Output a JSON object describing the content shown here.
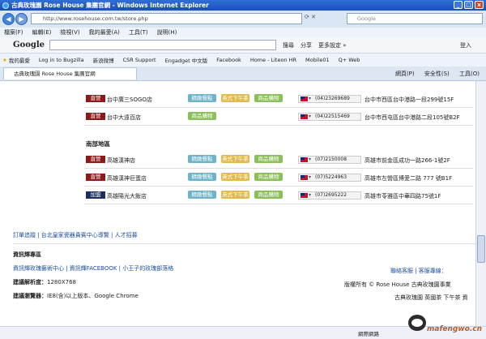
{
  "window": {
    "title": "古典玫瑰園 Rose House 集團官網 - Windows Internet Explorer",
    "controls": [
      "_",
      "□",
      "x"
    ]
  },
  "addressbar": {
    "url": "http://www.rosehouse.com.tw/store.php",
    "search_placeholder": "Google"
  },
  "menu": [
    "檔案(F)",
    "編輯(E)",
    "檢視(V)",
    "我的最愛(A)",
    "工具(T)",
    "說明(H)"
  ],
  "google_toolbar": {
    "logo": "Google",
    "search_btn": "搜尋",
    "share_btn": "分享",
    "more_btn": "更多設定 »",
    "login": "登入"
  },
  "favorites": [
    "我的最愛",
    "Log in to Bugzilla",
    "新浪微博",
    "CSR Support",
    "Engadget 中文版",
    "Facebook",
    "Home - Liteon HR",
    "Mobile01",
    "Q+ Web"
  ],
  "tab": {
    "label": "古典玫瑰園 Rose House 集團官網"
  },
  "tabtools": [
    "網頁(P)",
    "安全性(S)",
    "工具(O)"
  ],
  "stores_top": [
    {
      "badge": "直營",
      "name": "台中廣三SOGO店",
      "tags": [
        "精緻餐點",
        "英式下午茶",
        "商品購物"
      ],
      "phone": "(04)23269689",
      "address": "台中市西區台中港路一段299號15F"
    },
    {
      "badge": "直營",
      "name": "台中大遠百店",
      "tags": [
        "商品購物"
      ],
      "phone": "(04)22515469",
      "address": "台中市西屯區台中港路二段105號B2F"
    }
  ],
  "region_south": "南部地區",
  "stores_south": [
    {
      "badge": "直營",
      "name": "高雄漢神店",
      "tags": [
        "精緻餐點",
        "英式下午茶",
        "商品購物"
      ],
      "phone": "(07)2150008",
      "address": "高雄市前金區成功一路266-1號2F"
    },
    {
      "badge": "直營",
      "name": "高雄漢神巨蛋店",
      "tags": [
        "精緻餐點",
        "英式下午茶",
        "商品購物"
      ],
      "phone": "(07)5224963",
      "address": "高雄市左營區博愛二路 777 號B1F"
    },
    {
      "badge": "加盟",
      "name": "高雄陽光大飯店",
      "tags": [
        "精緻餐點",
        "英式下午茶",
        "商品購物"
      ],
      "phone": "(07)2695222",
      "address": "高雄市苓雅區中華四路75號1F"
    }
  ],
  "footer": {
    "links": "訂單追蹤 | 台北皇家瓷器貴賓中心導覽 | 人才招募",
    "title": "資訊輝專區",
    "links2": "資訊輝玫瑰藝術中心 | 資訊輝FACEBOOK | 小王子的玫瑰部落格",
    "resolution_label": "建議解析度：",
    "resolution": "1280X768",
    "browser_label": "建議瀏覽器：",
    "browser": "IE8(含)以上版本、Google Chrome",
    "contact": "聯絡客服 | 客服專線：",
    "copyright": "版權所有 © Rose House 古典玫瑰園事業",
    "brand": "古典玫瑰園 英國茶 下午茶 資"
  },
  "status": {
    "zone": "網際網路"
  },
  "watermark": "mafengwo.cn"
}
